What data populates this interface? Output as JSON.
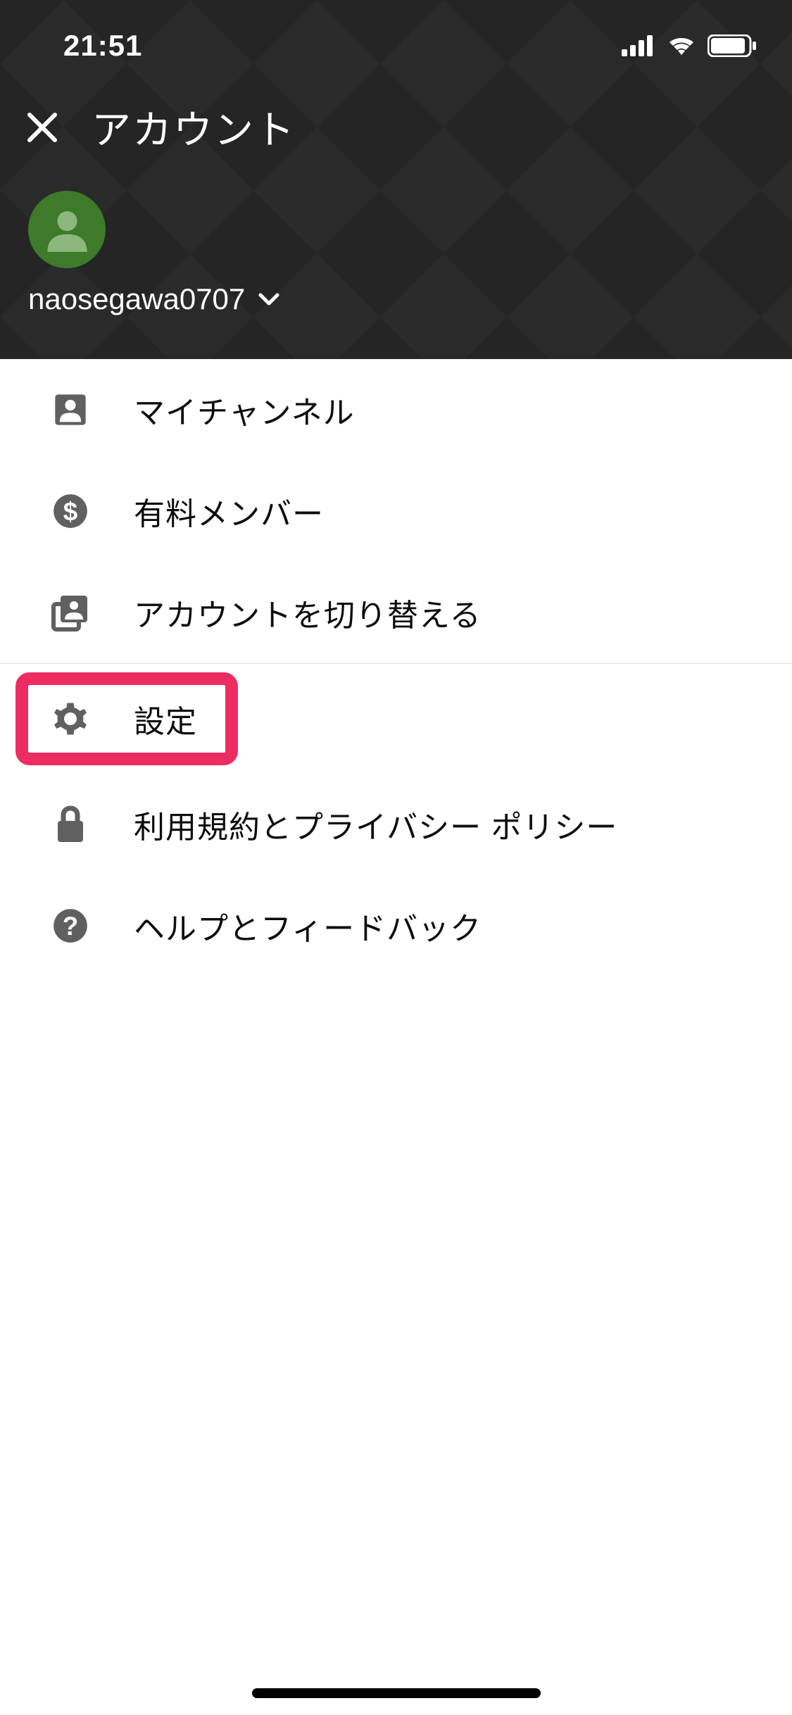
{
  "status": {
    "time": "21:51"
  },
  "header": {
    "title": "アカウント"
  },
  "user": {
    "name": "naosegawa0707"
  },
  "menu": {
    "group1": {
      "mychannel": "マイチャンネル",
      "paid": "有料メンバー",
      "switch": "アカウントを切り替える"
    },
    "group2": {
      "settings": "設定",
      "terms": "利用規約とプライバシー ポリシー",
      "help": "ヘルプとフィードバック"
    }
  }
}
